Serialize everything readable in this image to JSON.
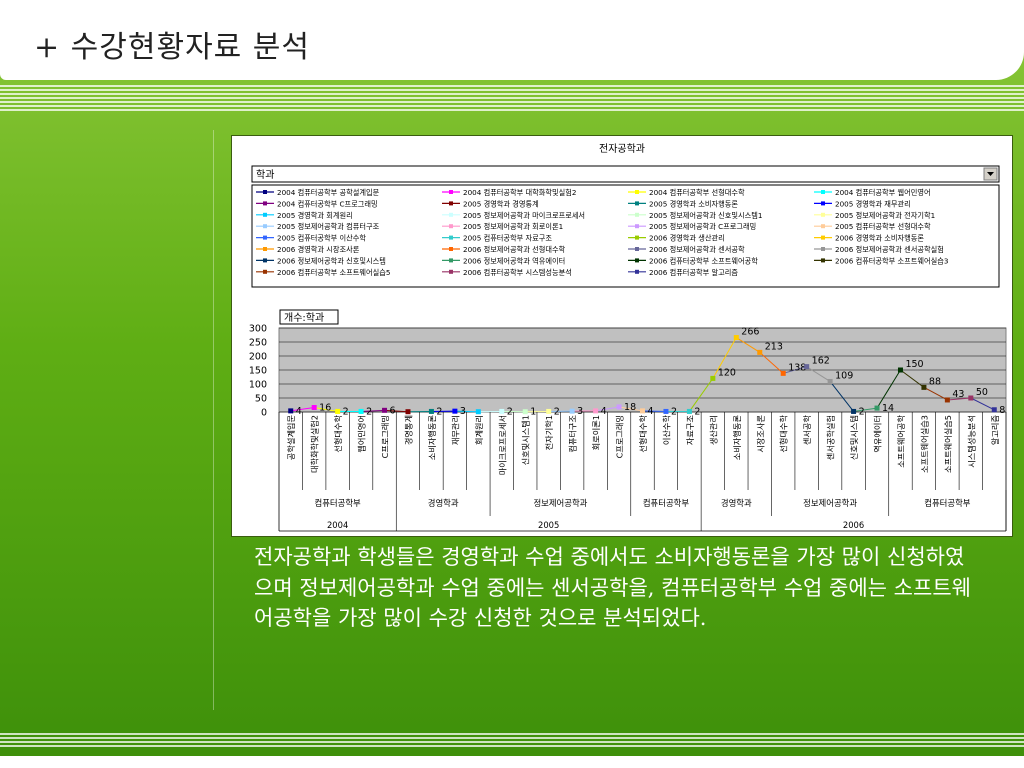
{
  "slide": {
    "title": "+  수강현황자료 분석",
    "body": "전자공학과 학생들은 경영학과 수업 중에서도 소비자행동론을 가장 많이 신청하였으며 정보제어공학과 수업 중에는 센서공학을, 컴퓨터공학부 수업 중에는 소프트웨어공학을 가장 많이 수강 신청한 것으로 분석되었다."
  },
  "chart_data": {
    "type": "line",
    "title": "전자공학과",
    "filter_label": "학과",
    "field_label": "개수:학과",
    "ylim": [
      0,
      300
    ],
    "yticks": [
      "300",
      "250",
      "200",
      "150",
      "100",
      "50",
      "0"
    ],
    "grid": true,
    "legend_position": "top",
    "legend": [
      "2004 컴퓨터공학부 공학설계입문",
      "2004 컴퓨터공학부 대학화학및실험2",
      "2004 컴퓨터공학부 선형대수학",
      "2004 컴퓨터공학부 웹어민영어",
      "2004 컴퓨터공학부 C프로그래밍",
      "2005 경영학과 경영통계",
      "2005 경영학과 소비자행동론",
      "2005 경영학과 재무관리",
      "2005 경영학과 회계원리",
      "2005 정보제어공학과 마이크로프로세서",
      "2005 정보제어공학과 신호및시스템1",
      "2005 정보제어공학과 전자기학1",
      "2005 정보제어공학과 컴퓨터구조",
      "2005 정보제어공학과 회로이론1",
      "2005 정보제어공학과 C프로그래밍",
      "2005 컴퓨터공학부 선형대수학",
      "2005 컴퓨터공학부 이산수학",
      "2005 컴퓨터공학부 자료구조",
      "2006 경영학과 생산관리",
      "2006 경영학과 소비자행동론",
      "2006 경영학과 시장조사론",
      "2006 정보제어공학과 선형대수학",
      "2006 정보제어공학과 센서공학",
      "2006 정보제어공학과 센서공학실험",
      "2006 정보제어공학과 신호및시스템",
      "2006 정보제어공학과 역유에이터",
      "2006 컴퓨터공학부 소프트웨어공학",
      "2006 컴퓨터공학부 소프트웨어실습3",
      "2006 컴퓨터공학부 소프트웨어실습5",
      "2006 컴퓨터공학부 시스템성능분석",
      "2006 컴퓨터공학부 알고리즘"
    ],
    "categories": [
      "공학설계입문",
      "대학화학및실험2",
      "선형대수학",
      "웹어민영어",
      "C프로그래밍",
      "경영통계",
      "소비자행동론",
      "재무관리",
      "회계원리",
      "마이크로프로세서",
      "신호및시스템1",
      "전자기학1",
      "컴퓨터구조",
      "회로이론1",
      "C프로그래밍",
      "선형대수학",
      "이산수학",
      "자료구조",
      "생산관리",
      "소비자행동론",
      "시장조사론",
      "선형대수학",
      "센서공학",
      "센서공학실험",
      "신호및시스템",
      "역유에이터",
      "소프트웨어공학",
      "소프트웨어실습3",
      "소프트웨어실습5",
      "시스템성능분석",
      "알고리즘"
    ],
    "values": [
      4,
      16,
      2,
      2,
      6,
      1,
      2,
      3,
      1,
      2,
      1,
      2,
      3,
      4,
      18,
      4,
      2,
      2,
      120,
      266,
      213,
      138,
      162,
      109,
      2,
      14,
      150,
      88,
      43,
      50,
      8
    ],
    "point_labels": [
      "4",
      "16",
      "2",
      "2",
      "6",
      "",
      "2",
      "3",
      "",
      "2",
      "1",
      "2",
      "3",
      "4",
      "18",
      "4",
      "2",
      "2",
      "120",
      "266",
      "213",
      "138",
      "162",
      "109",
      "2",
      "14",
      "150",
      "88",
      "43",
      "50",
      "8"
    ],
    "series_colors": [
      "#000080",
      "#ff00ff",
      "#ffff00",
      "#00ffff",
      "#800080",
      "#800000",
      "#008080",
      "#0000ff",
      "#00ccff",
      "#ccffff",
      "#ccffcc",
      "#ffff99",
      "#99ccff",
      "#ff99cc",
      "#cc99ff",
      "#ffcc99",
      "#3366ff",
      "#33cccc",
      "#99cc00",
      "#ffcc00",
      "#ff9900",
      "#ff6600",
      "#666699",
      "#969696",
      "#003366",
      "#339966",
      "#003300",
      "#333300",
      "#993300",
      "#993366",
      "#333399"
    ],
    "dept_groups": [
      {
        "label": "컴퓨터공학부",
        "start": 0,
        "end": 4
      },
      {
        "label": "경영학과",
        "start": 5,
        "end": 8
      },
      {
        "label": "정보제어공학과",
        "start": 9,
        "end": 14
      },
      {
        "label": "컴퓨터공학부",
        "start": 15,
        "end": 17
      },
      {
        "label": "경영학과",
        "start": 18,
        "end": 20
      },
      {
        "label": "정보제어공학과",
        "start": 21,
        "end": 25
      },
      {
        "label": "컴퓨터공학부",
        "start": 26,
        "end": 30
      }
    ],
    "year_groups": [
      {
        "label": "2004",
        "start": 0,
        "end": 4
      },
      {
        "label": "2005",
        "start": 5,
        "end": 17
      },
      {
        "label": "2006",
        "start": 18,
        "end": 30
      }
    ]
  }
}
